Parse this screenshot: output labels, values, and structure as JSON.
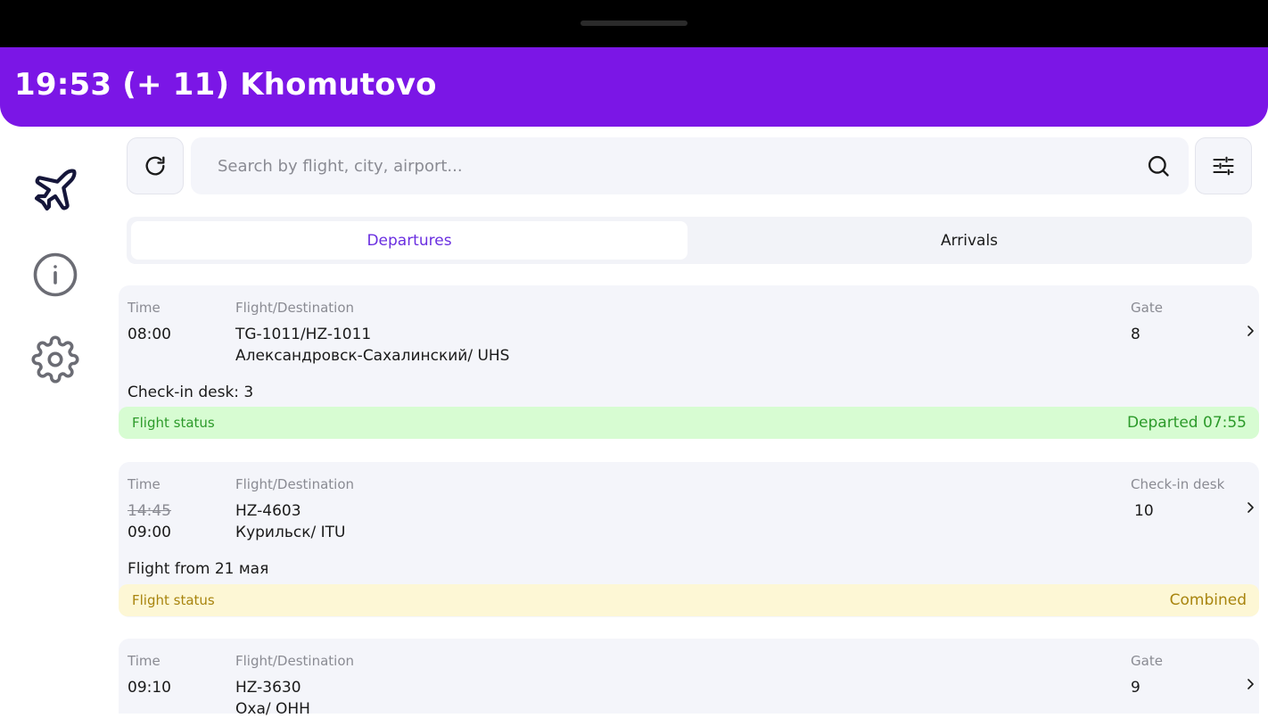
{
  "header": {
    "title": "19:53 (+ 11) Khomutovo"
  },
  "sidebar": {
    "items": [
      {
        "name": "flights",
        "icon": "airplane-icon"
      },
      {
        "name": "info",
        "icon": "info-icon"
      },
      {
        "name": "settings",
        "icon": "gear-icon"
      }
    ]
  },
  "toolbar": {
    "refresh_icon": "refresh-icon",
    "filter_icon": "filter-sliders-icon",
    "search": {
      "placeholder": "Search by flight, city, airport...",
      "value": ""
    }
  },
  "tabs": [
    {
      "label": "Departures",
      "active": true
    },
    {
      "label": "Arrivals",
      "active": false
    }
  ],
  "flights": [
    {
      "time_label": "Time",
      "flight_label": "Flight/Destination",
      "right_label": "Gate",
      "time": "08:00",
      "flight": "TG-1011/HZ-1011",
      "destination": "Александровск-Сахалинский/ UHS",
      "right_value": "8",
      "extra": "Check-in desk:  3",
      "status_label": "Flight status",
      "status_value": "Departed 07:55",
      "status_color": "green"
    },
    {
      "time_label": "Time",
      "flight_label": "Flight/Destination",
      "right_label": "Check-in desk",
      "old_time": "14:45",
      "time": "09:00",
      "flight": "HZ-4603",
      "destination": "Курильск/ ITU",
      "right_value": "10",
      "extra": "Flight from 21 мая",
      "status_label": "Flight status",
      "status_value": "Combined",
      "status_color": "yellow"
    },
    {
      "time_label": "Time",
      "flight_label": "Flight/Destination",
      "right_label": "Gate",
      "time": "09:10",
      "flight": "HZ-3630",
      "destination": "Оха/ OHH",
      "right_value": "9"
    }
  ],
  "colors": {
    "brand": "#7b16e6",
    "status_green_bg": "#d7fcd2",
    "status_green_text": "#2c9a2a",
    "status_yellow_bg": "#fdf7d5",
    "status_yellow_text": "#a8840e"
  }
}
